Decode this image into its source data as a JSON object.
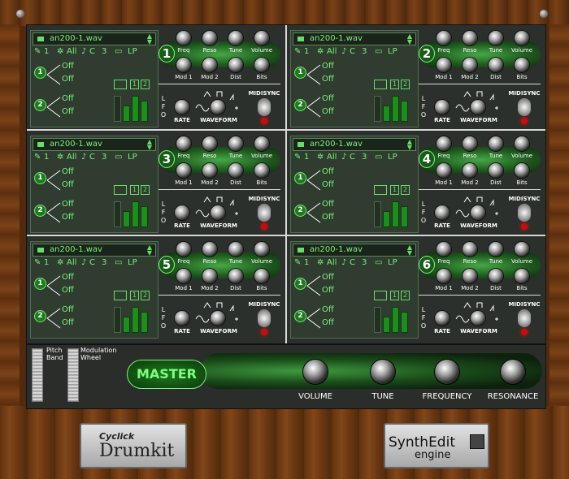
{
  "app": {
    "logo_small": "Cyclick",
    "logo_big": "Drumkit",
    "engine_line1": "SynthEdit",
    "engine_line2": "engine"
  },
  "voice_common": {
    "file_name": "an200-1.wav",
    "channel": "1",
    "all_label": "All",
    "note_label": "C",
    "octave": "3",
    "filter_type": "LP",
    "trigger1_num": "1",
    "trigger2_num": "2",
    "off1": "Off",
    "off2": "Off",
    "off3": "Off",
    "off4": "Off",
    "wave_num1": "1",
    "wave_num2": "2",
    "knob_labels": [
      "Freq",
      "Reso",
      "Tune",
      "Volume",
      "Mod 1",
      "Mod 2",
      "Dist",
      "Bits"
    ],
    "lfo_letters": [
      "L",
      "F",
      "O"
    ],
    "rate_label": "RATE",
    "waveform_label": "WAVEFORM",
    "midisync_label": "MIDISYNC"
  },
  "voices": [
    {
      "number": "1"
    },
    {
      "number": "2"
    },
    {
      "number": "3"
    },
    {
      "number": "4"
    },
    {
      "number": "5"
    },
    {
      "number": "6"
    }
  ],
  "master": {
    "label": "MASTER",
    "pitch_band_label": "Pitch Band",
    "mod_wheel_label": "Modulation Wheel",
    "knobs": [
      "VOLUME",
      "TUNE",
      "FREQUENCY",
      "RESONANCE"
    ]
  },
  "colors": {
    "accent": "#2f8f2f",
    "text_green": "#7cf07c",
    "led_red": "#c21010"
  }
}
